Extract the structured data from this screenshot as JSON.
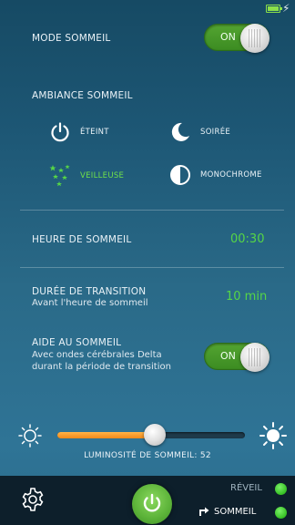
{
  "status": {
    "battery": "full",
    "charging": true
  },
  "mode_sommeil": {
    "label": "MODE SOMMEIL",
    "toggle": "ON"
  },
  "ambiance": {
    "title": "AMBIANCE SOMMEIL",
    "options": [
      {
        "label": "ÉTEINT",
        "icon": "power-icon",
        "selected": false
      },
      {
        "label": "SOIRÉE",
        "icon": "moon-icon",
        "selected": false
      },
      {
        "label": "VEILLEUSE",
        "icon": "stars-icon",
        "selected": true
      },
      {
        "label": "MONOCHROME",
        "icon": "half-circle-icon",
        "selected": false
      }
    ]
  },
  "heure": {
    "label": "HEURE DE SOMMEIL",
    "value": "00:30"
  },
  "transition": {
    "label": "DURÉE DE TRANSITION",
    "sub": "Avant l'heure de sommeil",
    "value": "10 min"
  },
  "aide": {
    "label": "AIDE AU SOMMEIL",
    "sub1": "Avec ondes cérébrales Delta",
    "sub2": "durant la période de transition",
    "toggle": "ON"
  },
  "luminosite": {
    "label": "LUMINOSITÉ DE SOMMEIL: 52",
    "value": 52,
    "max": 100
  },
  "bottom": {
    "reveil": "RÉVEIL",
    "sommeil": "SOMMEIL",
    "colors": {
      "accent": "#56d646",
      "slider": "#f08a1a"
    }
  }
}
